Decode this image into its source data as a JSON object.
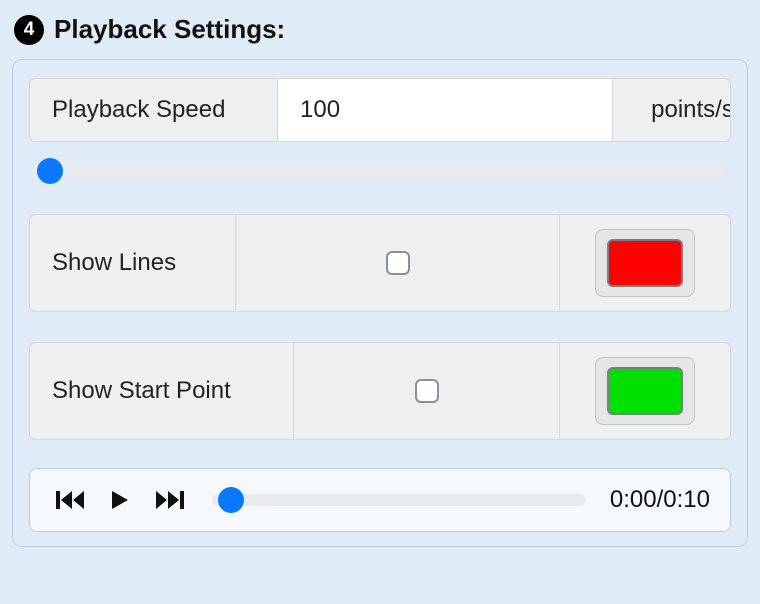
{
  "header": {
    "step_number": "4",
    "title": "Playback Settings:"
  },
  "speed": {
    "label": "Playback Speed",
    "value": "100",
    "unit": "points/s",
    "slider_percent": 3
  },
  "show_lines": {
    "label": "Show Lines",
    "checked": false,
    "color": "#ff0000"
  },
  "show_start": {
    "label": "Show Start Point",
    "checked": false,
    "color": "#00e000"
  },
  "playback": {
    "position_percent": 6,
    "time": "0:00/0:10"
  }
}
